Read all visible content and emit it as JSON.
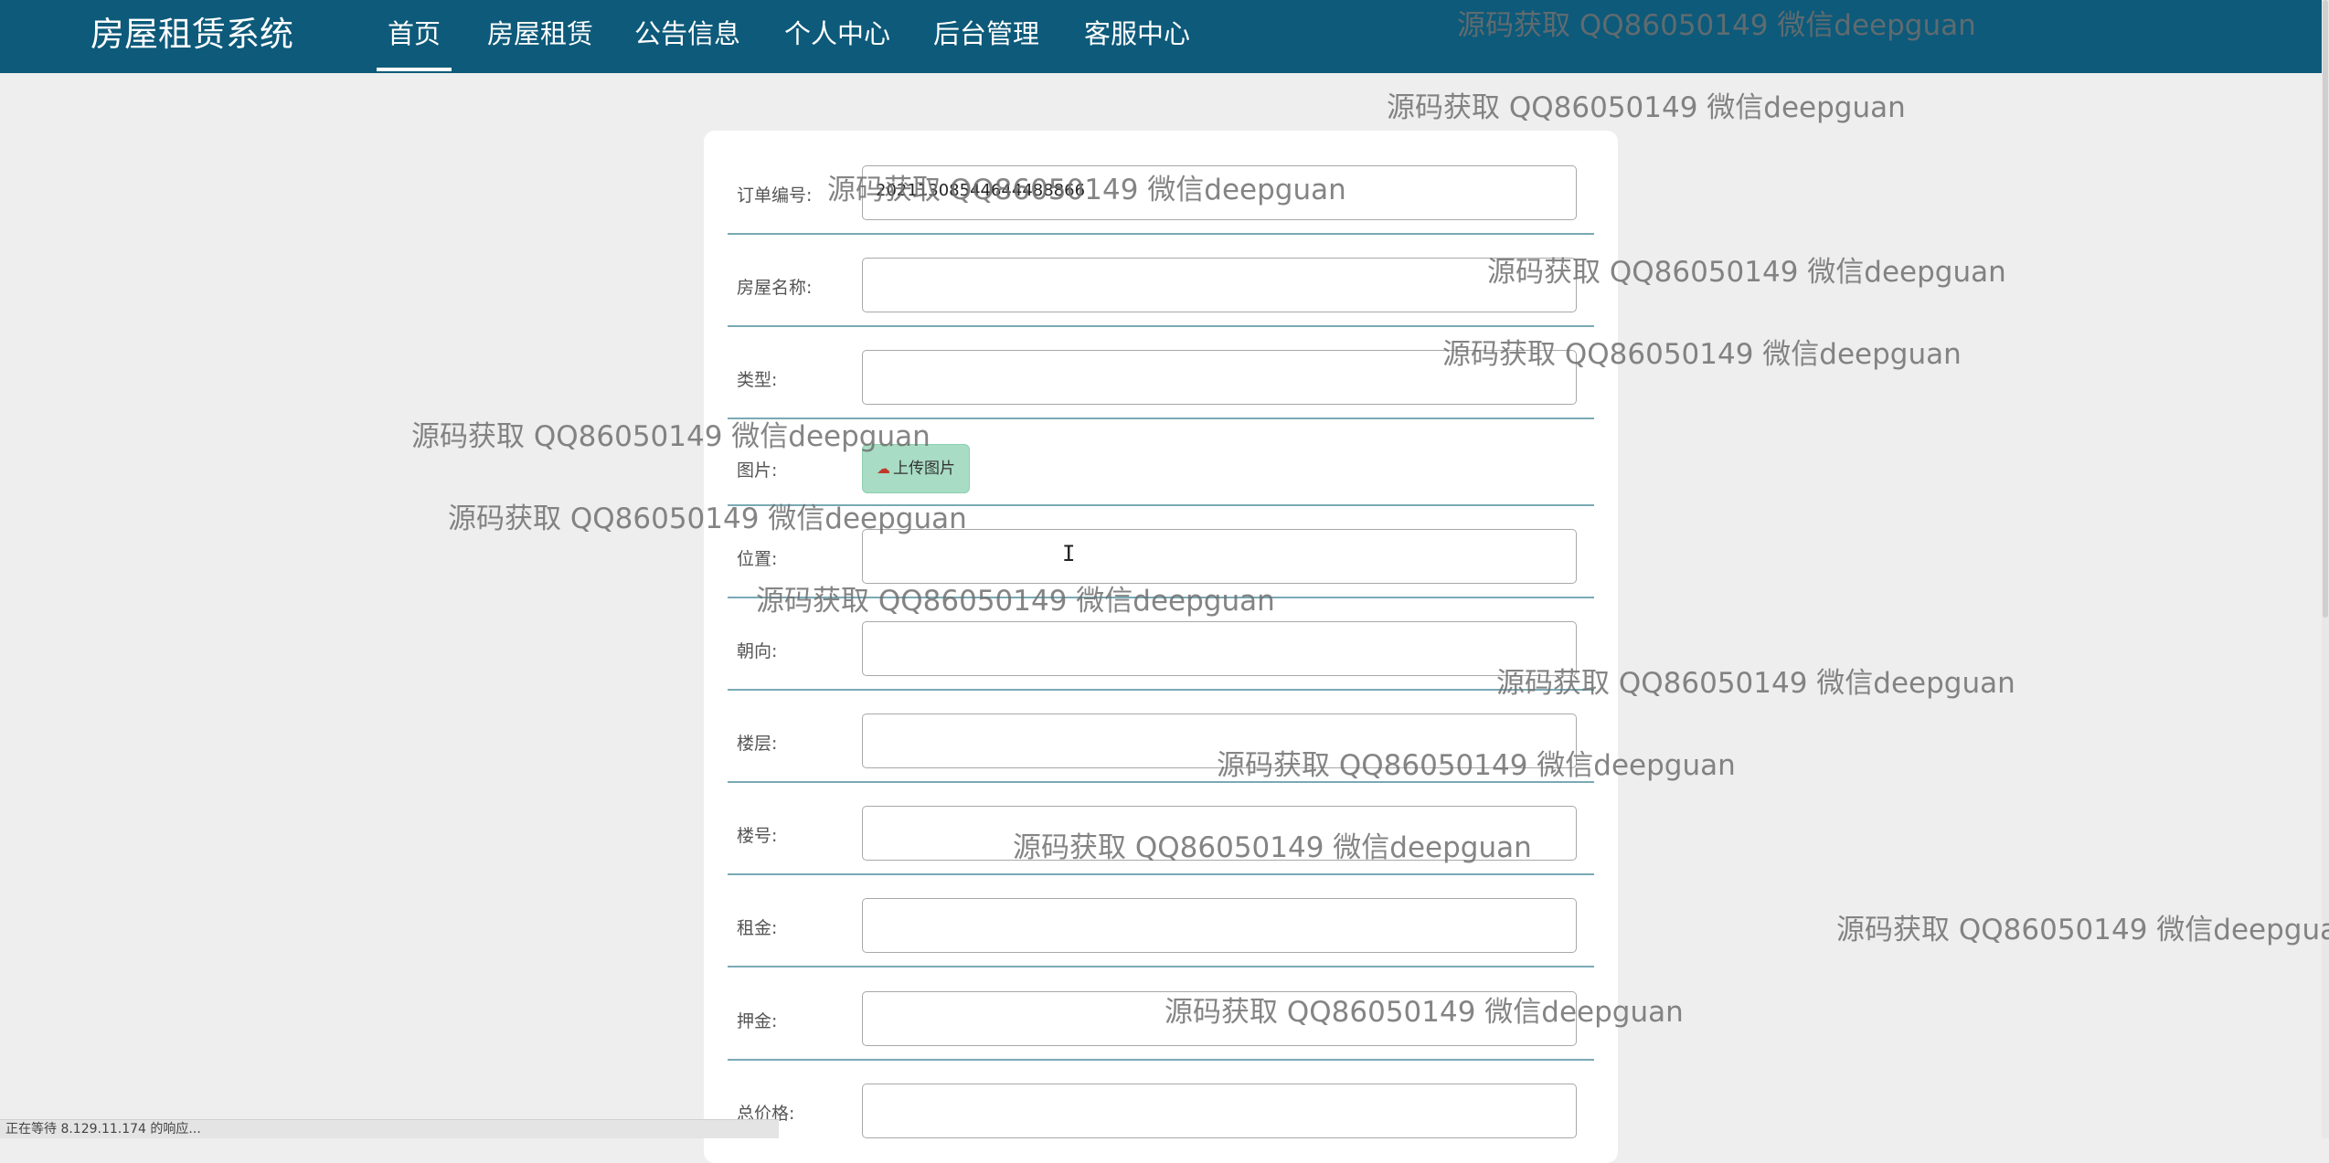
{
  "nav": {
    "brand": "房屋租赁系统",
    "items": [
      {
        "label": "首页",
        "active": true
      },
      {
        "label": "房屋租赁",
        "active": false
      },
      {
        "label": "公告信息",
        "active": false
      },
      {
        "label": "个人中心",
        "active": false
      },
      {
        "label": "后台管理",
        "active": false
      },
      {
        "label": "客服中心",
        "active": false
      }
    ]
  },
  "form": {
    "order_no": {
      "label": "订单编号:",
      "value": "20211308544644488866"
    },
    "house_name": {
      "label": "房屋名称:",
      "value": ""
    },
    "type": {
      "label": "类型:",
      "value": ""
    },
    "image": {
      "label": "图片:",
      "upload_label": "上传图片",
      "upload_icon": "cloud-upload-icon"
    },
    "location": {
      "label": "位置:",
      "value": ""
    },
    "orientation": {
      "label": "朝向:",
      "value": ""
    },
    "floor": {
      "label": "楼层:",
      "value": ""
    },
    "building_no": {
      "label": "楼号:",
      "value": ""
    },
    "rent": {
      "label": "租金:",
      "value": ""
    },
    "deposit": {
      "label": "押金:",
      "value": ""
    },
    "total_price": {
      "label": "总价格:",
      "value": ""
    }
  },
  "watermark": "源码获取 QQ86050149 微信deepguan",
  "status_bar": "正在等待 8.129.11.174 的响应...",
  "colors": {
    "navbar": "#0d5a7a",
    "upload_button": "#a8dcc4",
    "divider": "#7aa9b5",
    "page_background": "#eeeeee"
  }
}
